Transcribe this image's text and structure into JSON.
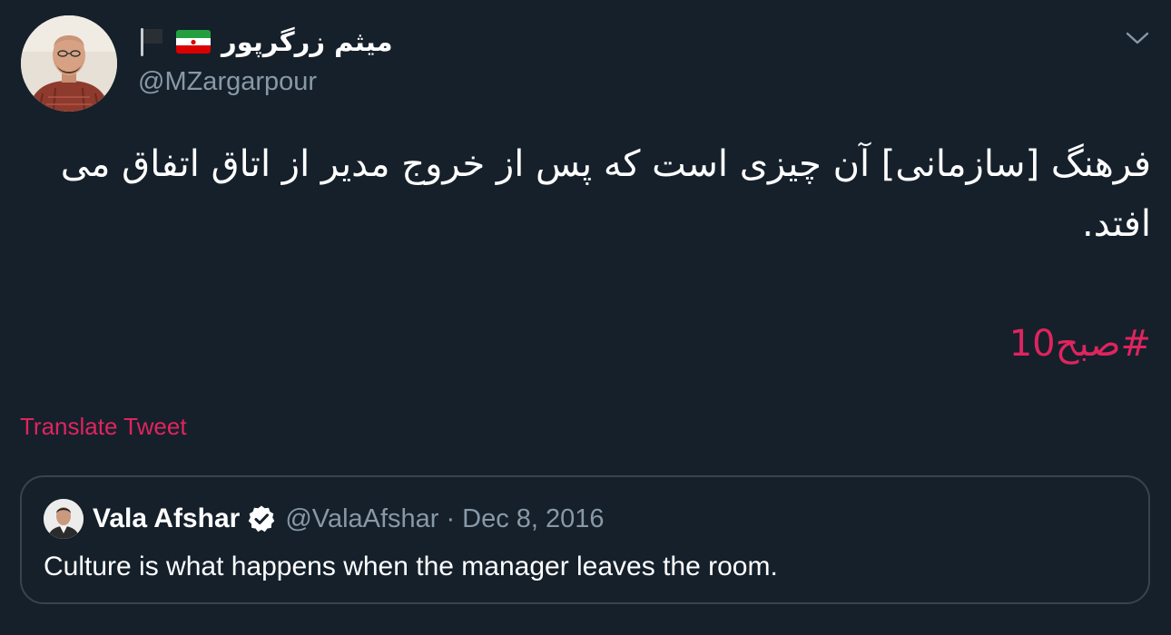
{
  "tweet": {
    "author": {
      "display_name": "میثم زرگرپور",
      "handle": "@MZargarpour",
      "avatar_icon": "user-avatar-photo",
      "flags": [
        "black-flag-icon",
        "iran-flag-icon"
      ]
    },
    "text": "فرهنگ [سازمانی] آن چیزی است که پس از خروج مدیر از اتاق اتفاق می افتد.",
    "hashtag": "#صبح10",
    "translate_label": "Translate Tweet",
    "menu_icon": "chevron-down-icon"
  },
  "quoted_tweet": {
    "display_name": "Vala Afshar",
    "verified": true,
    "handle": "@ValaAfshar",
    "separator": "·",
    "date": "Dec 8, 2016",
    "text": "Culture is what happens when the manager leaves the room."
  },
  "colors": {
    "background": "#15202b",
    "text": "#ffffff",
    "secondary_text": "#8899a6",
    "accent": "#e0245e",
    "border": "#38444d"
  }
}
